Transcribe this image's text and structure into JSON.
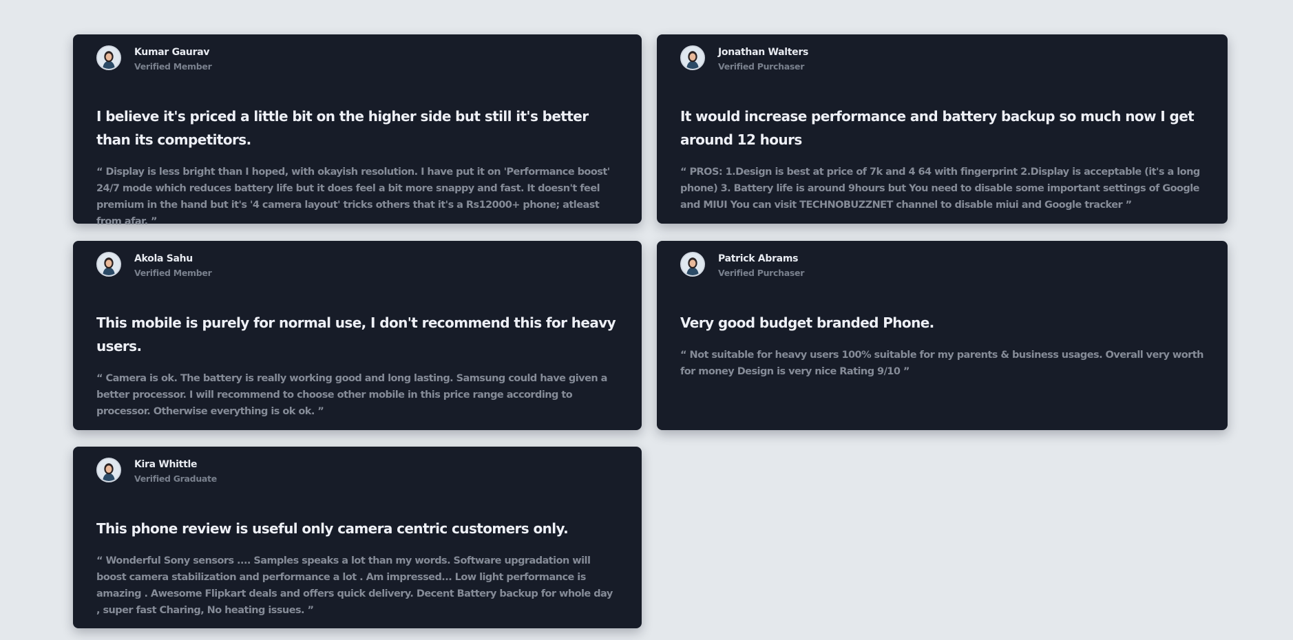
{
  "reviews": [
    {
      "name": "Kumar Gaurav",
      "role": "Verified Member",
      "avatar_icon": "user-avatar-icon",
      "headline": "I believe it's priced a little bit on the higher side but still it's better than its competitors.",
      "quote": "“ Display is less bright than I hoped, with okayish resolution. I have put it on 'Performance boost' 24/7 mode which reduces battery life but it does feel a bit more snappy and fast. It doesn't feel premium in the hand but it's '4 camera layout' tricks others that it's a Rs12000+ phone; atleast from afar. ”"
    },
    {
      "name": "Jonathan Walters",
      "role": "Verified Purchaser",
      "avatar_icon": "user-avatar-icon",
      "headline": "It would increase performance and battery backup so much now I get around 12 hours",
      "quote": "“ PROS: 1.Design is best at price of 7k and 4 64 with fingerprint 2.Display is acceptable (it's a long phone) 3. Battery life is around 9hours but You need to disable some important settings of Google and MIUI You can visit TECHNOBUZZNET channel to disable miui and Google tracker ”"
    },
    {
      "name": "Akola Sahu",
      "role": "Verified Member",
      "avatar_icon": "user-avatar-icon",
      "headline": "This mobile is purely for normal use, I don't recommend this for heavy users.",
      "quote": "“ Camera is ok. The battery is really working good and long lasting. Samsung could have given a better processor. I will recommend to choose other mobile in this price range according to processor. Otherwise everything is ok ok. ”"
    },
    {
      "name": "Patrick Abrams",
      "role": "Verified Purchaser",
      "avatar_icon": "user-avatar-icon",
      "headline": "Very good budget branded Phone.",
      "quote": "“ Not suitable for heavy users 100% suitable for my parents & business usages. Overall very worth for money Design is very nice Rating 9/10 ”"
    },
    {
      "name": "Kira Whittle",
      "role": "Verified Graduate",
      "avatar_icon": "user-avatar-icon",
      "headline": "This phone review is useful only camera centric customers only.",
      "quote": "“ Wonderful Sony sensors .... Samples speaks a lot than my words. Software upgradation will boost camera stabilization and performance a lot . Am impressed... Low light performance is amazing . Awesome Flipkart deals and offers quick delivery. Decent Battery backup for whole day , super fast Charing, No heating issues. ”"
    }
  ],
  "colors": {
    "page_background": "#e4e8ec",
    "card_background": "#171c28",
    "headline_text": "#eef0f6",
    "name_text": "#e8ebf1",
    "muted_text": "#858b97"
  }
}
